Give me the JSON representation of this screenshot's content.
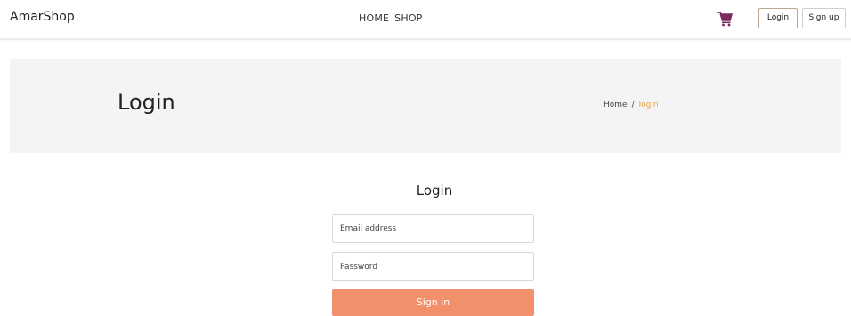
{
  "navbar": {
    "brand": "AmarShop",
    "links": [
      {
        "label": "HOME"
      },
      {
        "label": "SHOP"
      }
    ],
    "cart_icon": "shopping-cart-icon",
    "login_label": "Login",
    "signup_label": "Sign up"
  },
  "banner": {
    "title": "Login",
    "breadcrumb": {
      "home": "Home",
      "separator": "/",
      "current": "login"
    }
  },
  "form": {
    "title": "Login",
    "email_placeholder": "Email address",
    "email_value": "",
    "password_placeholder": "Password",
    "password_value": "",
    "submit_label": "Sign in"
  },
  "colors": {
    "accent": "#f1906b",
    "cart": "#7a2a5a",
    "breadcrumb_current": "#e8a23a",
    "banner_bg": "#f4f4f4"
  }
}
